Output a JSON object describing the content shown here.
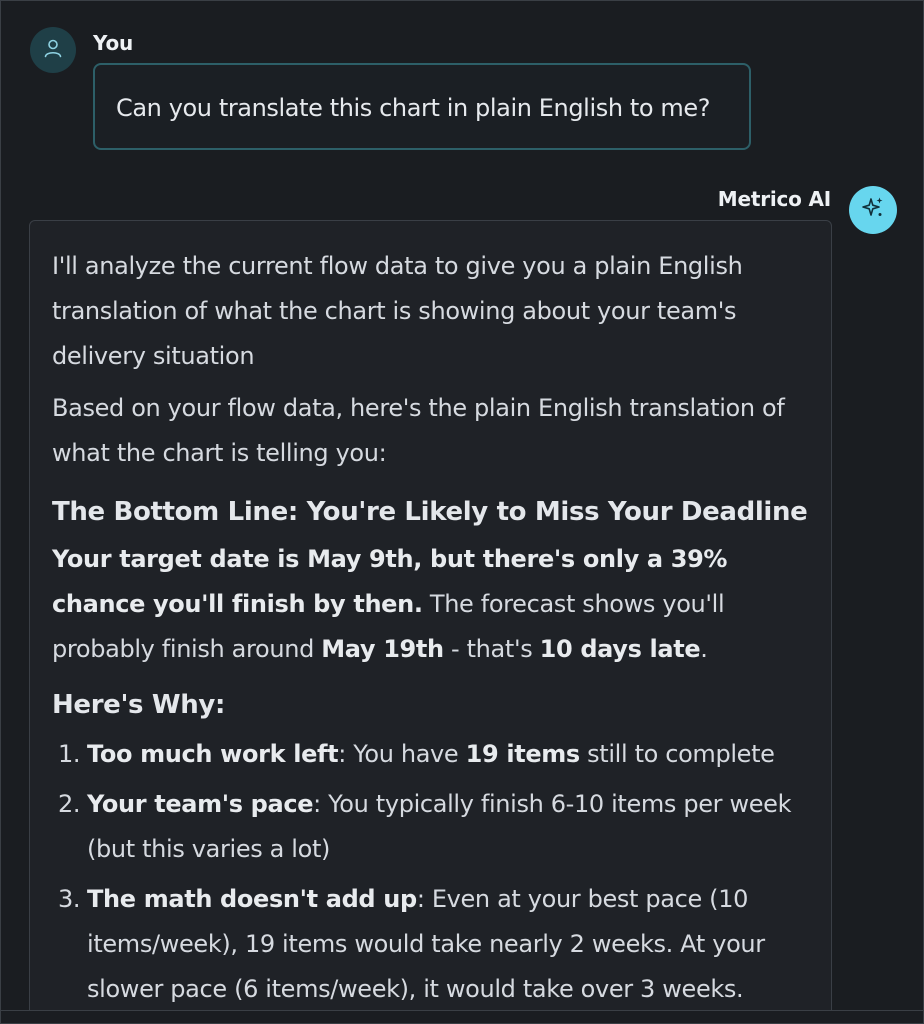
{
  "user": {
    "name": "You",
    "message": "Can you translate this chart in plain English to me?"
  },
  "assistant": {
    "name": "Metrico AI",
    "intro": "I'll analyze the current flow data to give you a plain English translation of what the chart is showing about your team's delivery situation",
    "para2": "Based on your flow data, here's the plain English translation of what the chart is telling you:",
    "heading1": "The Bottom Line: You're Likely to Miss Your Deadline",
    "summary": {
      "bold_lead": "Your target date is May 9th, but there's only a 39% chance you'll finish by then.",
      "text_a": " The forecast shows you'll probably finish around ",
      "bold_date": "May 19th",
      "text_b": " - that's ",
      "bold_late": "10 days late",
      "text_c": "."
    },
    "heading2": "Here's Why:",
    "reasons": [
      {
        "num": "1.",
        "title": "Too much work left",
        "text_a": ": You have ",
        "bold": "19 items",
        "text_b": " still to complete"
      },
      {
        "num": "2.",
        "title": "Your team's pace",
        "text": ": You typically finish 6-10 items per week (but this varies a lot)"
      },
      {
        "num": "3.",
        "title": "The math doesn't add up",
        "text": ": Even at your best pace (10 items/week), 19 items would take nearly 2 weeks. At your slower pace (6 items/week), it would take over 3 weeks."
      }
    ]
  },
  "colors": {
    "background": "#1a1d21",
    "bubble": "#1f2227",
    "user_border": "#2d5f68",
    "ai_avatar": "#67d6ee",
    "user_avatar": "#1f3f47"
  }
}
